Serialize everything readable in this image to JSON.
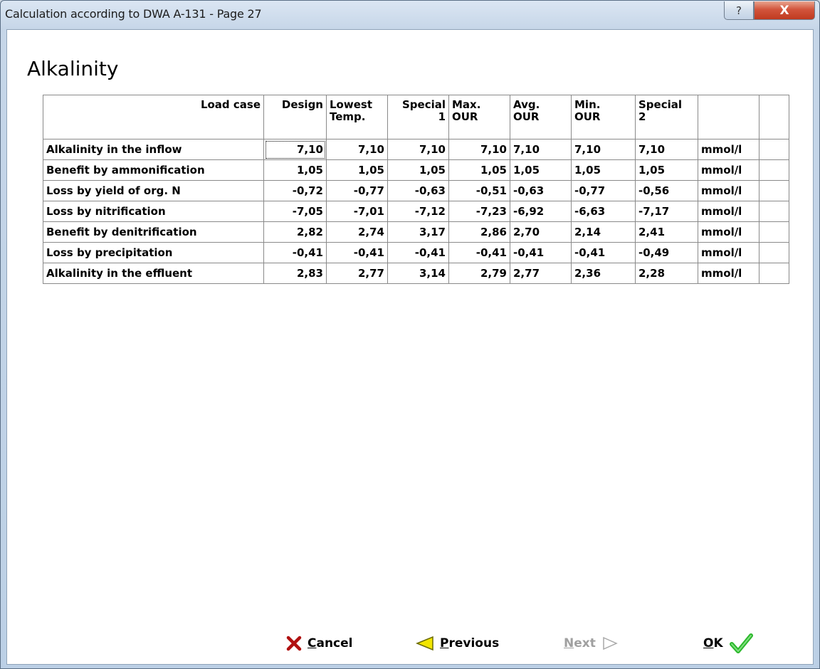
{
  "window": {
    "title": "Calculation according to DWA  A-131 - Page 27",
    "help_glyph": "?",
    "close_glyph": "X"
  },
  "page": {
    "heading": "Alkalinity"
  },
  "table": {
    "corner_label": "Load case",
    "columns": [
      {
        "line1": "Design",
        "line2": ""
      },
      {
        "line1": "Lowest",
        "line2": "Temp."
      },
      {
        "line1": "Special",
        "line2": "1"
      },
      {
        "line1": "Max.",
        "line2": "OUR"
      },
      {
        "line1": "Avg.",
        "line2": "OUR"
      },
      {
        "line1": "Min.",
        "line2": "OUR"
      },
      {
        "line1": "Special",
        "line2": "2"
      }
    ],
    "rows": [
      {
        "label": "Alkalinity in the inflow",
        "values": [
          "7,10",
          "7,10",
          "7,10",
          "7,10",
          "7,10",
          "7,10",
          "7,10"
        ],
        "unit": "mmol/l"
      },
      {
        "label": "Benefit by ammonification",
        "values": [
          "1,05",
          "1,05",
          "1,05",
          "1,05",
          "1,05",
          "1,05",
          "1,05"
        ],
        "unit": "mmol/l"
      },
      {
        "label": "Loss by yield of org. N",
        "values": [
          "-0,72",
          "-0,77",
          "-0,63",
          "-0,51",
          "-0,63",
          "-0,77",
          "-0,56"
        ],
        "unit": "mmol/l"
      },
      {
        "label": "Loss by nitrification",
        "values": [
          "-7,05",
          "-7,01",
          "-7,12",
          "-7,23",
          "-6,92",
          "-6,63",
          "-7,17"
        ],
        "unit": "mmol/l"
      },
      {
        "label": "Benefit by denitrification",
        "values": [
          "2,82",
          "2,74",
          "3,17",
          "2,86",
          "2,70",
          "2,14",
          "2,41"
        ],
        "unit": "mmol/l"
      },
      {
        "label": "Loss by precipitation",
        "values": [
          "-0,41",
          "-0,41",
          "-0,41",
          "-0,41",
          "-0,41",
          "-0,41",
          "-0,49"
        ],
        "unit": "mmol/l"
      },
      {
        "label": "Alkalinity in the effluent",
        "values": [
          "2,83",
          "2,77",
          "3,14",
          "2,79",
          "2,77",
          "2,36",
          "2,28"
        ],
        "unit": "mmol/l"
      }
    ]
  },
  "buttons": {
    "cancel": {
      "accel": "C",
      "rest": "ancel",
      "icon": "red-x-icon",
      "color": "#b01010"
    },
    "previous": {
      "accel": "P",
      "rest": "revious",
      "icon": "yellow-left-arrow-icon",
      "color": "#f2e600"
    },
    "next": {
      "accel": "N",
      "rest": "ext",
      "icon": "right-arrow-outline-icon",
      "disabled": true
    },
    "ok": {
      "accel": "O",
      "rest": "K",
      "icon": "green-check-icon",
      "color": "#2db82d"
    }
  }
}
